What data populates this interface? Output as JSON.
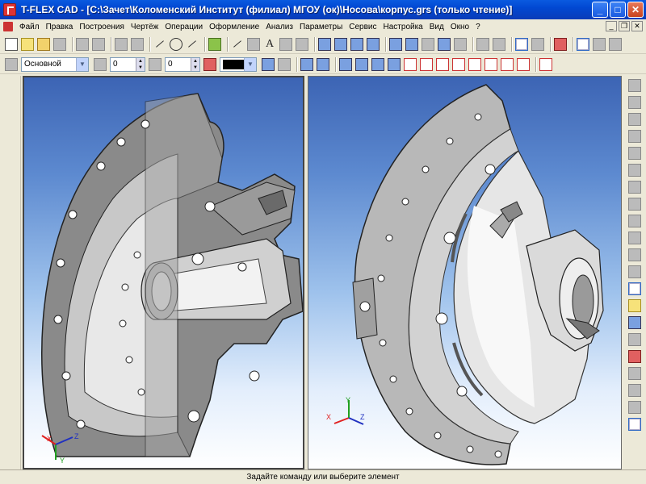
{
  "window": {
    "title": "T-FLEX CAD - [C:\\Зачет\\Коломенский Институт (филиал) МГОУ (ок)\\Носова\\корпус.grs (только чтение)]",
    "minimize": "_",
    "maximize": "□",
    "close": "✕"
  },
  "menu": {
    "items": [
      "Файл",
      "Правка",
      "Построения",
      "Чертёж",
      "Операции",
      "Оформление",
      "Анализ",
      "Параметры",
      "Сервис",
      "Настройка",
      "Вид",
      "Окно",
      "?"
    ],
    "mdi_minimize": "_",
    "mdi_restore": "❐",
    "mdi_close": "✕"
  },
  "toolbar2": {
    "layer_value": "Основной",
    "spin1_value": "0",
    "spin2_value": "0"
  },
  "statusbar": {
    "text": "Задайте команду или выберите элемент"
  },
  "axes": {
    "x_label": "X",
    "y_label": "Y",
    "z_label": "Z",
    "x_color": "#e02020",
    "y_color": "#20a020",
    "z_color": "#2030c0"
  },
  "colors": {
    "title_bar": "#0148d2",
    "viewport_top": "#3c64b4",
    "viewport_bottom": "#ffffff",
    "model_gray": "#9a9a9a"
  }
}
